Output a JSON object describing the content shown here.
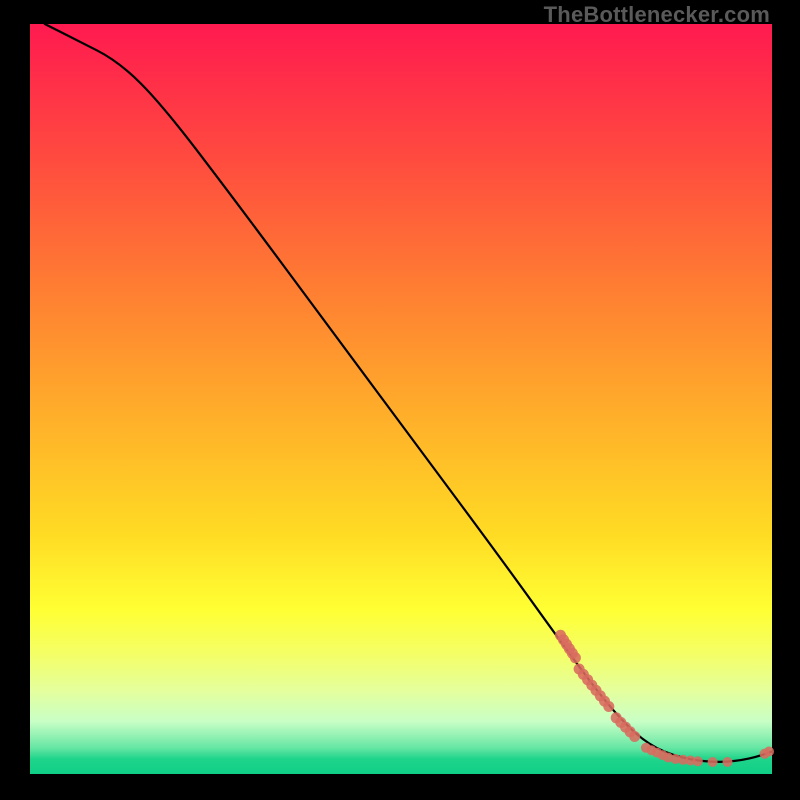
{
  "watermark": "TheBottlenecker.com",
  "colors": {
    "dot": "#d86b5f",
    "curve": "#000000"
  },
  "chart_data": {
    "type": "line",
    "title": "",
    "xlabel": "",
    "ylabel": "",
    "xlim": [
      0,
      100
    ],
    "ylim": [
      0,
      100
    ],
    "grid": false,
    "legend": false,
    "curve": [
      {
        "x": 2,
        "y": 100
      },
      {
        "x": 6,
        "y": 98
      },
      {
        "x": 12,
        "y": 95
      },
      {
        "x": 18,
        "y": 89
      },
      {
        "x": 28,
        "y": 76
      },
      {
        "x": 40,
        "y": 60
      },
      {
        "x": 52,
        "y": 44
      },
      {
        "x": 64,
        "y": 28
      },
      {
        "x": 72,
        "y": 17
      },
      {
        "x": 78,
        "y": 9
      },
      {
        "x": 83,
        "y": 4
      },
      {
        "x": 88,
        "y": 2
      },
      {
        "x": 93,
        "y": 1.5
      },
      {
        "x": 97,
        "y": 2
      },
      {
        "x": 100,
        "y": 3
      }
    ],
    "dot_clusters": [
      {
        "start_x": 71.5,
        "end_x": 73.5,
        "y_start": 18.5,
        "y_end": 15.5,
        "count": 6,
        "r": 5.5
      },
      {
        "start_x": 74.0,
        "end_x": 78.0,
        "y_start": 14.0,
        "y_end": 9.0,
        "count": 8,
        "r": 5.5
      },
      {
        "start_x": 79.0,
        "end_x": 81.5,
        "y_start": 7.5,
        "y_end": 5.0,
        "count": 5,
        "r": 5.5
      },
      {
        "start_x": 83.0,
        "end_x": 86.0,
        "y_start": 3.5,
        "y_end": 2.2,
        "count": 5,
        "r": 5.0
      },
      {
        "start_x": 87.0,
        "end_x": 90.0,
        "y_start": 2.0,
        "y_end": 1.7,
        "count": 4,
        "r": 5.0
      },
      {
        "start_x": 92.0,
        "end_x": 94.0,
        "y_start": 1.6,
        "y_end": 1.6,
        "count": 2,
        "r": 5.0
      },
      {
        "start_x": 99.0,
        "end_x": 99.6,
        "y_start": 2.7,
        "y_end": 3.0,
        "count": 2,
        "r": 5.0
      }
    ]
  }
}
